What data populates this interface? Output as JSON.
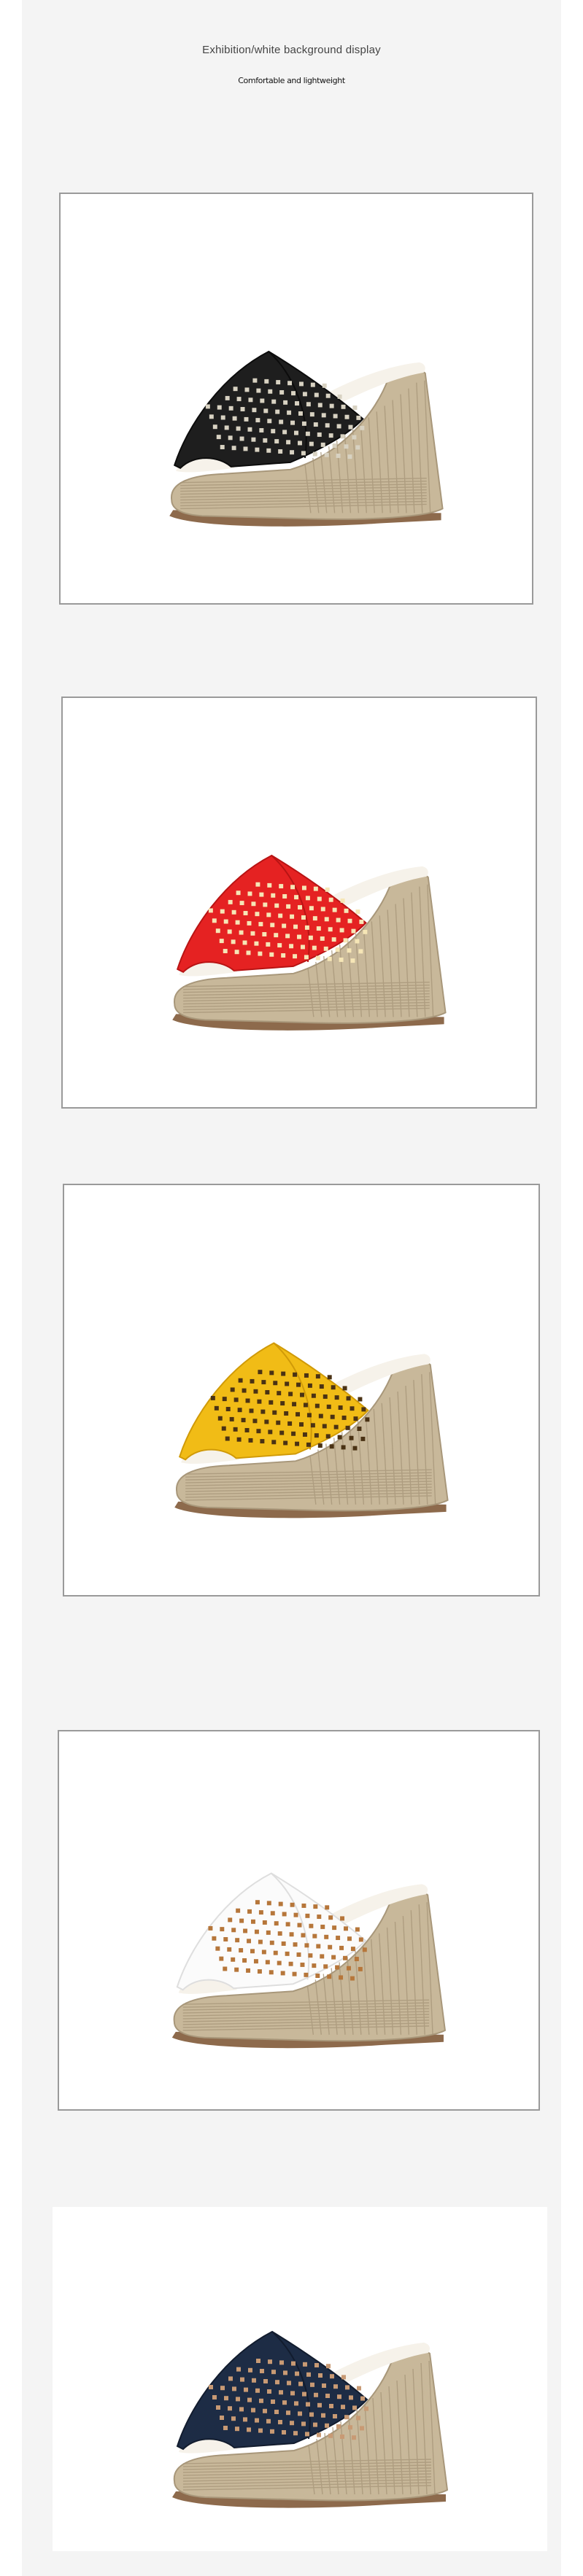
{
  "header": {
    "title": "Exhibition/white background display",
    "subtitle": "Comfortable and lightweight"
  },
  "products": [
    {
      "name": "shoe-black",
      "upper": "#1e1e1e",
      "upper_shade": "#0c0c0c",
      "hole": "#d8d2c2"
    },
    {
      "name": "shoe-red",
      "upper": "#e52222",
      "upper_shade": "#b81414",
      "hole": "#f6e6b6"
    },
    {
      "name": "shoe-yellow",
      "upper": "#f1bc16",
      "upper_shade": "#d09a08",
      "hole": "#4a3214"
    },
    {
      "name": "shoe-white",
      "upper": "#fbfbfb",
      "upper_shade": "#dedede",
      "hole": "#b6763a"
    },
    {
      "name": "shoe-navy",
      "upper": "#1d2c45",
      "upper_shade": "#121c2e",
      "hole": "#c89a74"
    }
  ],
  "colors": {
    "page_background": "#f4f4f4",
    "frame_border": "#9a9a9a",
    "jute": "#c8b89a",
    "jute_dark": "#a8977a",
    "sole": "#8d6a4c",
    "insole": "#f6f2ea"
  }
}
